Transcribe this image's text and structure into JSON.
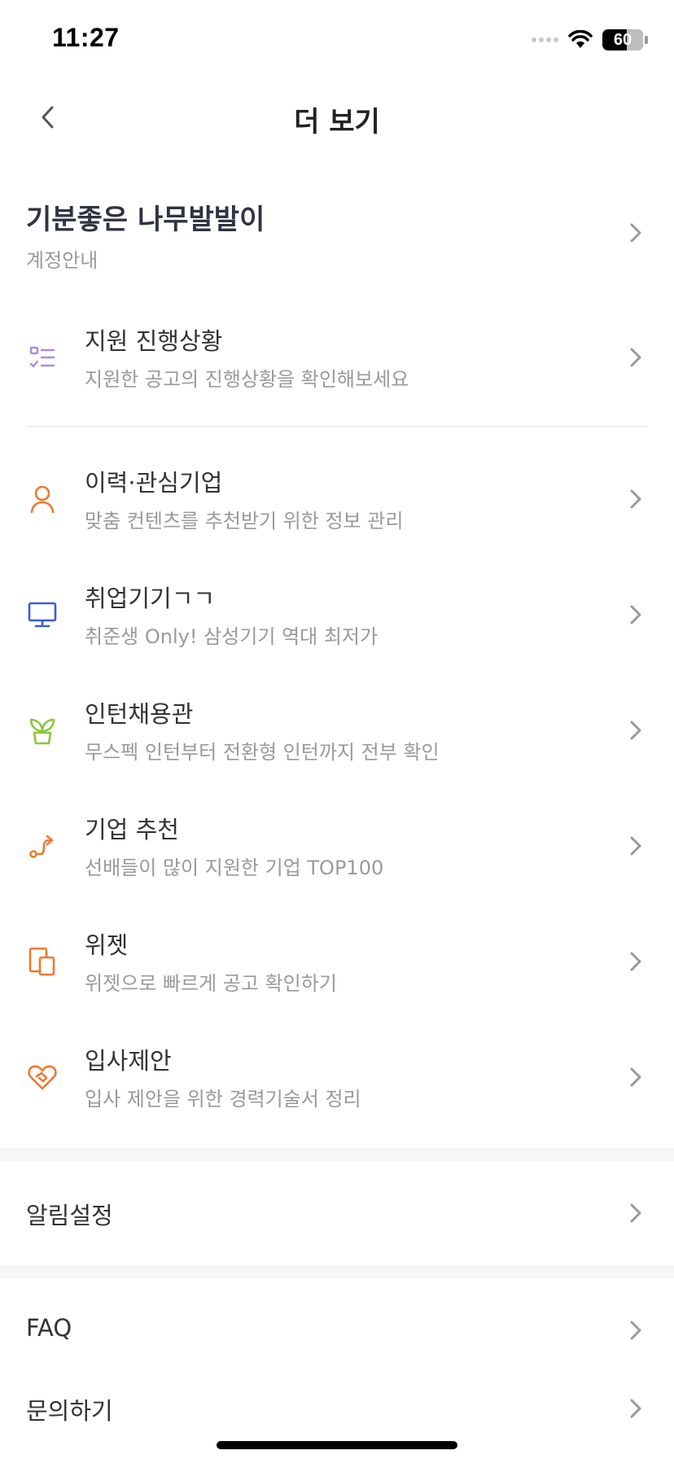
{
  "status": {
    "time": "11:27",
    "battery": "60",
    "battery_level": 60
  },
  "nav": {
    "title": "더 보기"
  },
  "profile": {
    "name": "기분좋은 나무발발이",
    "subtitle": "계정안내"
  },
  "menu": [
    {
      "title": "지원 진행상황",
      "subtitle": "지원한 공고의 진행상황을 확인해보세요",
      "icon": "checklist-icon",
      "color": "#a98be0"
    },
    {
      "title": "이력·관심기업",
      "subtitle": "맞춤 컨텐츠를 추천받기 위한 정보 관리",
      "icon": "person-icon",
      "color": "#ee7a2f"
    },
    {
      "title": "취업기기ㄱㄱ",
      "subtitle": "취준생 Only! 삼성기기 역대 최저가",
      "icon": "monitor-icon",
      "color": "#3b5bdb"
    },
    {
      "title": "인턴채용관",
      "subtitle": "무스펙 인턴부터 전환형 인턴까지 전부 확인",
      "icon": "sprout-icon",
      "color": "#8cc63f"
    },
    {
      "title": "기업 추천",
      "subtitle": "선배들이 많이 지원한 기업 TOP100",
      "icon": "route-icon",
      "color": "#ee7a2f"
    },
    {
      "title": "위젯",
      "subtitle": "위젯으로 빠르게 공고 확인하기",
      "icon": "widget-icon",
      "color": "#ee7a2f"
    },
    {
      "title": "입사제안",
      "subtitle": "입사 제안을 위한 경력기술서 정리",
      "icon": "heart-handshake-icon",
      "color": "#ee7a2f"
    }
  ],
  "settings": {
    "notification": "알림설정",
    "faq": "FAQ",
    "inquiry": "문의하기"
  }
}
